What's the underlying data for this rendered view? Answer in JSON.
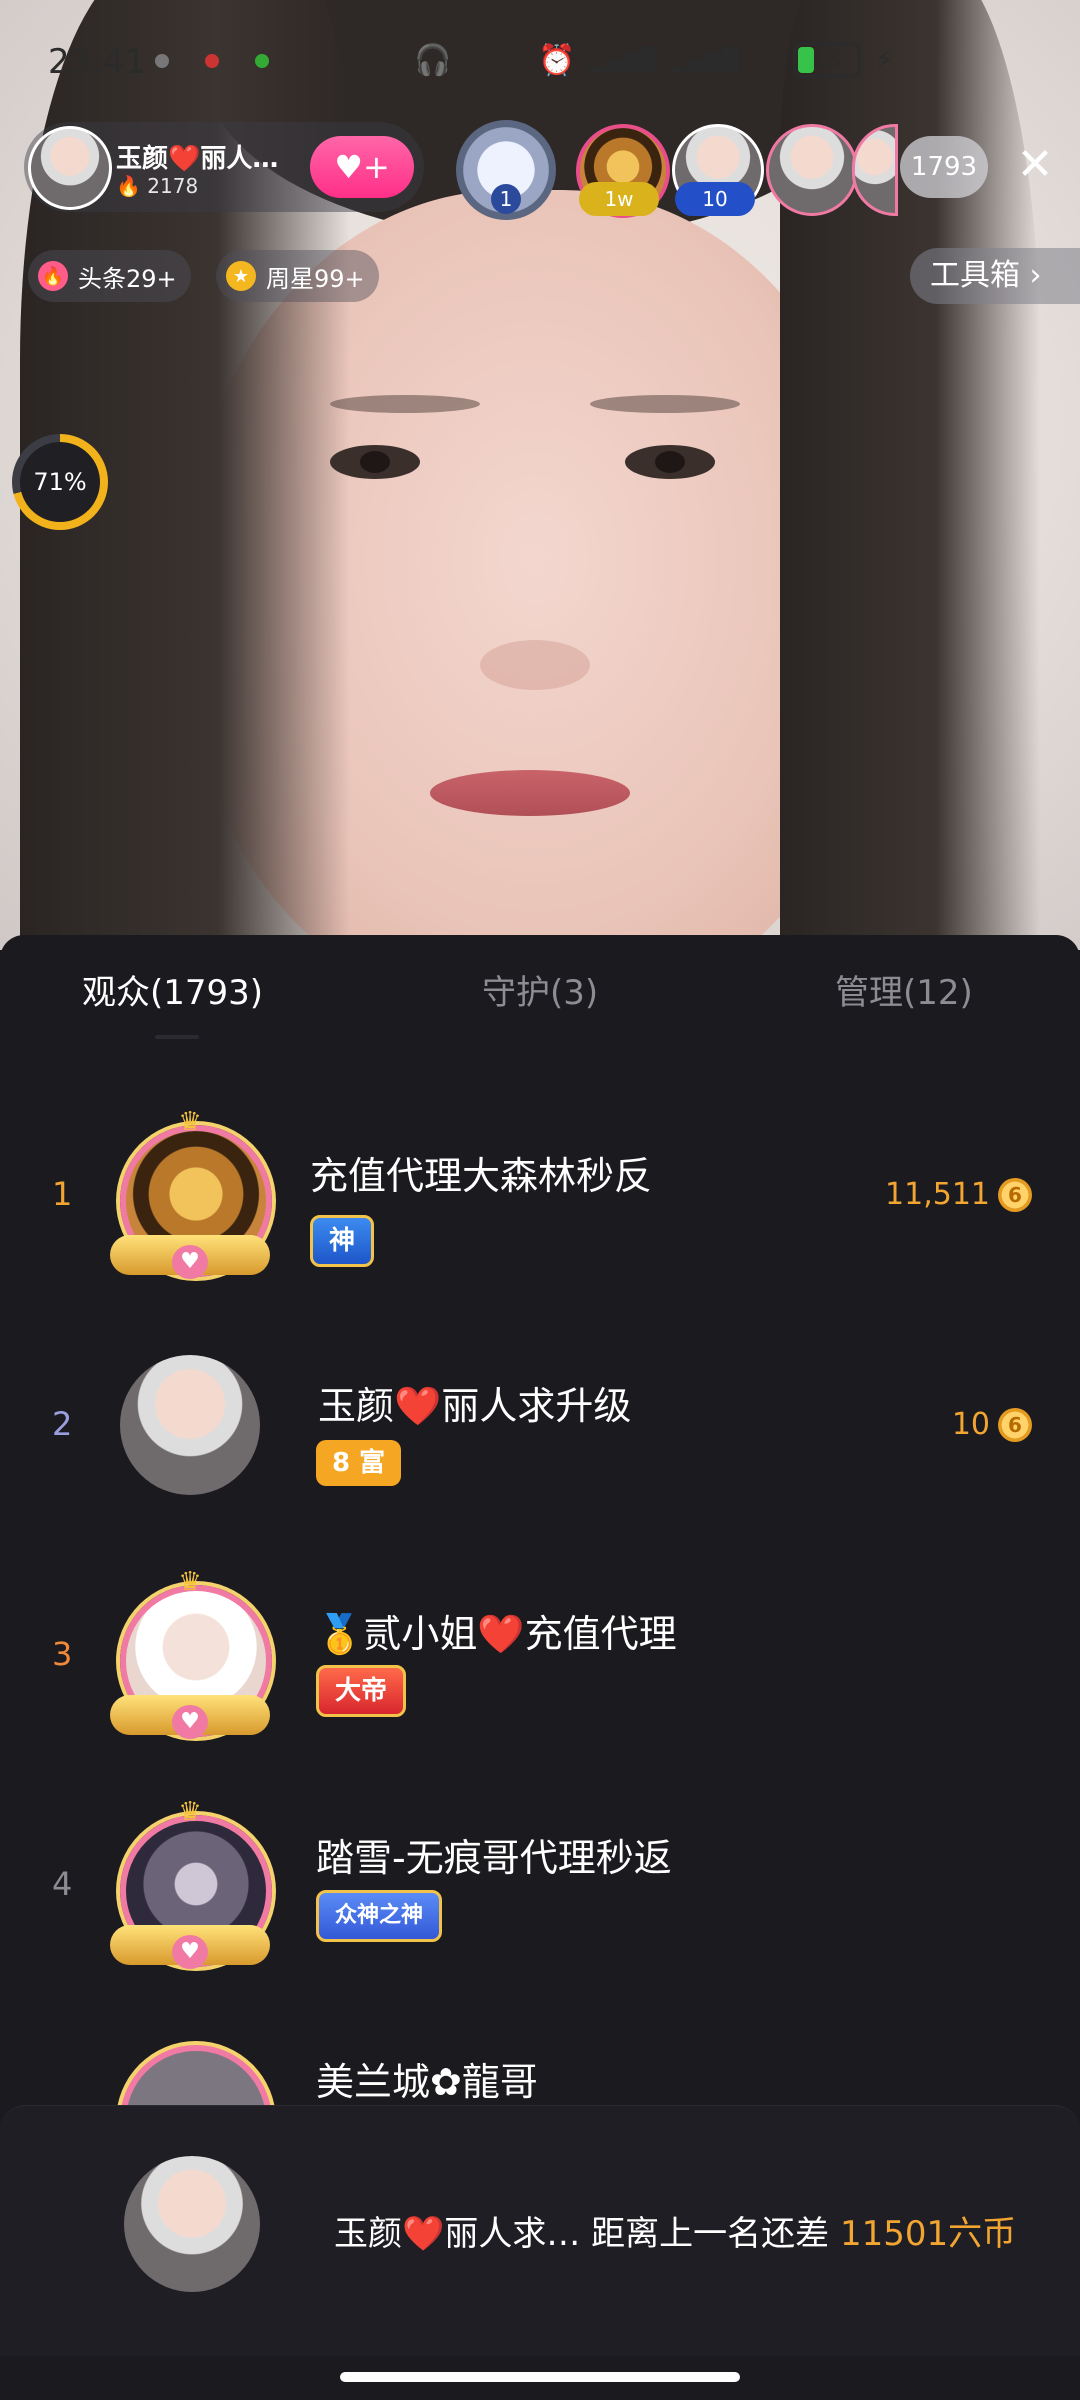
{
  "status_bar": {
    "time": "23:41",
    "battery": "18"
  },
  "host": {
    "name": "玉颜❤️丽人…",
    "fire_count": "2178",
    "fire_icon": "fire-icon",
    "follow_icon": "plus-heart-icon"
  },
  "top_viewers": [
    {
      "tag": "1"
    },
    {
      "tag": "1w"
    },
    {
      "tag": "10"
    }
  ],
  "viewer_count": "1793",
  "chips": [
    {
      "label": "头条29+",
      "icon": "fire-icon"
    },
    {
      "label": "周星99+",
      "icon": "star-icon"
    }
  ],
  "toolbox": {
    "label": "工具箱 ›"
  },
  "progress": {
    "label": "71%",
    "value": 0.71
  },
  "tabs": [
    {
      "label": "观众(1793)",
      "active": true
    },
    {
      "label": "守护(3)",
      "active": false
    },
    {
      "label": "管理(12)",
      "active": false
    }
  ],
  "rows": [
    {
      "rank": "1",
      "name": "充值代理大森林秒反",
      "badge": "神",
      "coins": "11,511"
    },
    {
      "rank": "2",
      "name": "玉颜❤️丽人求升级",
      "badge": "8 富",
      "coins": "10"
    },
    {
      "rank": "3",
      "name": "🥇贰小姐❤️充值代理",
      "badge": "大帝",
      "coins": ""
    },
    {
      "rank": "4",
      "name": "踏雪-无痕哥代理秒返",
      "badge": "众神之神",
      "coins": ""
    },
    {
      "rank": "5",
      "name": "美兰城✿龍哥",
      "badge": "",
      "coins": ""
    }
  ],
  "coin_symbol": "6",
  "footer": {
    "name": "玉颜❤️丽人求…",
    "text": "距离上一名还差",
    "gap": "11501六币"
  },
  "colors": {
    "accent_pink": "#ff2f88",
    "coin_gold": "#f3a531",
    "panel_bg": "#1b1a1f"
  }
}
